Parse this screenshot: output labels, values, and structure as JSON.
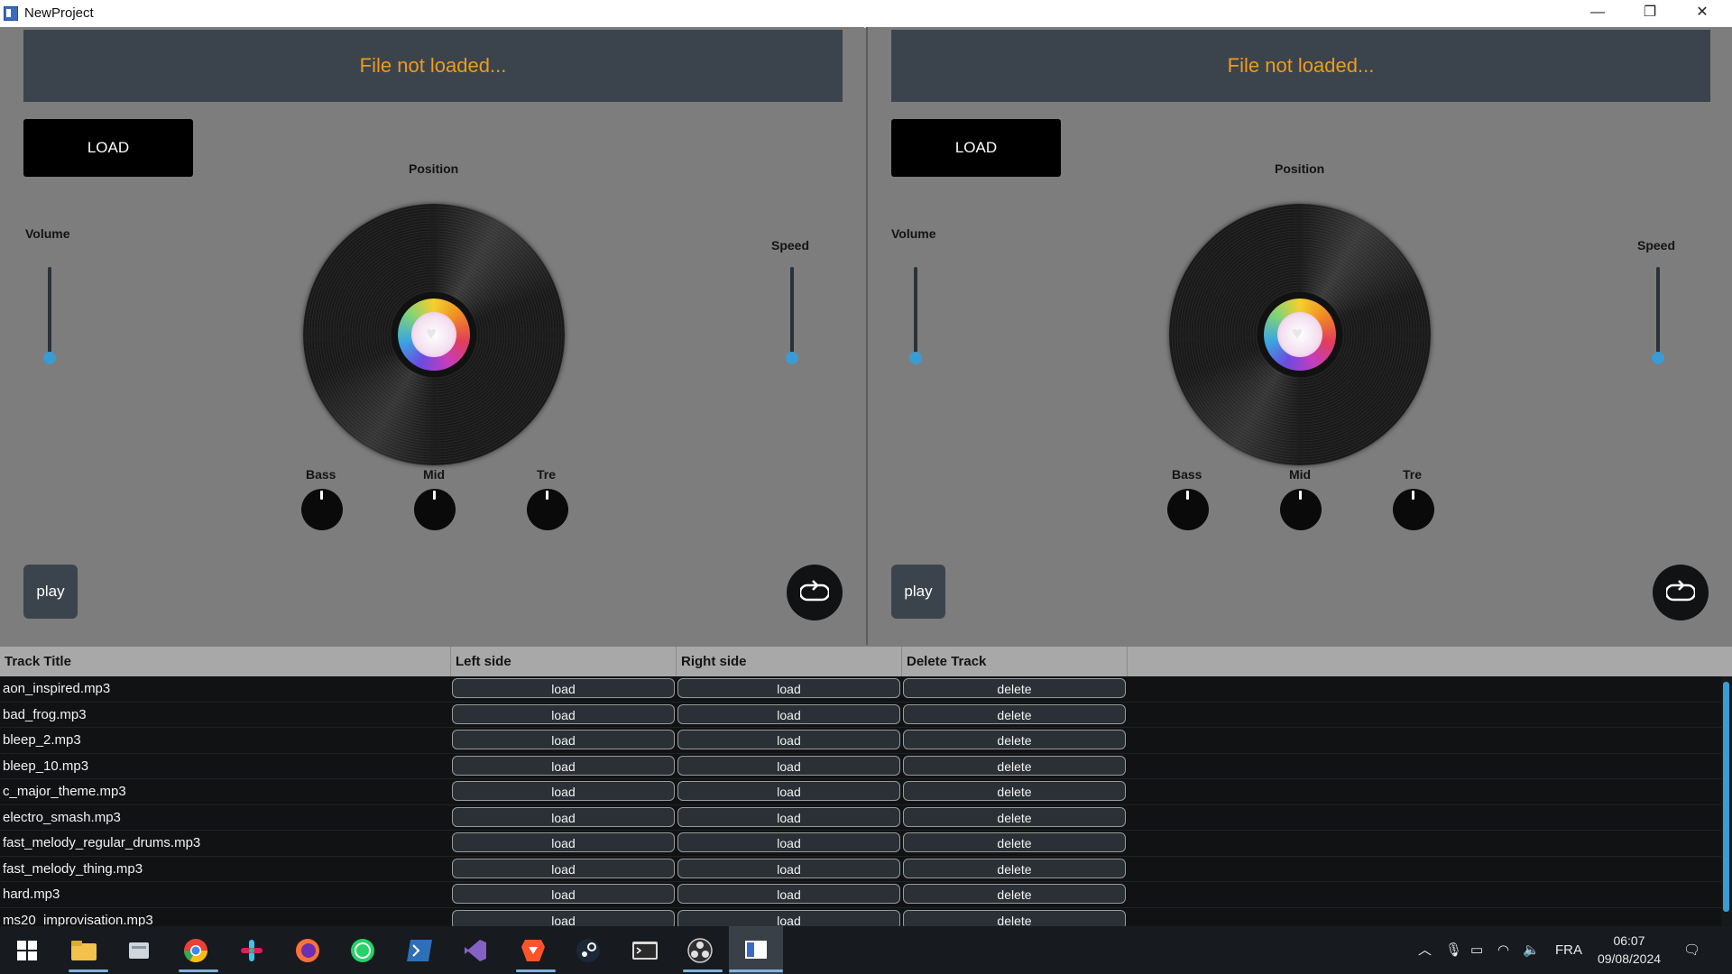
{
  "window": {
    "title": "NewProject",
    "controls": {
      "minimize": "—",
      "restore": "❐",
      "close": "✕"
    }
  },
  "decks": [
    {
      "id": "left",
      "file_status": "File not loaded...",
      "load_label": "LOAD",
      "position_label": "Position",
      "volume_label": "Volume",
      "speed_label": "Speed",
      "volume_level": 0.0,
      "speed_level": 0.0,
      "eq": {
        "bass": "Bass",
        "mid": "Mid",
        "tre": "Tre"
      },
      "play_label": "play"
    },
    {
      "id": "right",
      "file_status": "File not loaded...",
      "load_label": "LOAD",
      "position_label": "Position",
      "volume_label": "Volume",
      "speed_label": "Speed",
      "volume_level": 0.0,
      "speed_level": 0.0,
      "eq": {
        "bass": "Bass",
        "mid": "Mid",
        "tre": "Tre"
      },
      "play_label": "play"
    }
  ],
  "tracklist": {
    "headers": [
      "Track Title",
      "Left side",
      "Right side",
      "Delete Track"
    ],
    "rows": [
      {
        "title": "aon_inspired.mp3",
        "left": "load",
        "right": "load",
        "delete": "delete"
      },
      {
        "title": "bad_frog.mp3",
        "left": "load",
        "right": "load",
        "delete": "delete"
      },
      {
        "title": "bleep_2.mp3",
        "left": "load",
        "right": "load",
        "delete": "delete"
      },
      {
        "title": "bleep_10.mp3",
        "left": "load",
        "right": "load",
        "delete": "delete"
      },
      {
        "title": "c_major_theme.mp3",
        "left": "load",
        "right": "load",
        "delete": "delete"
      },
      {
        "title": "electro_smash.mp3",
        "left": "load",
        "right": "load",
        "delete": "delete"
      },
      {
        "title": "fast_melody_regular_drums.mp3",
        "left": "load",
        "right": "load",
        "delete": "delete"
      },
      {
        "title": "fast_melody_thing.mp3",
        "left": "load",
        "right": "load",
        "delete": "delete"
      },
      {
        "title": "hard.mp3",
        "left": "load",
        "right": "load",
        "delete": "delete"
      },
      {
        "title": "ms20_improvisation.mp3",
        "left": "load",
        "right": "load",
        "delete": "delete"
      }
    ]
  },
  "taskbar": {
    "apps": [
      "windows-start-icon",
      "file-explorer-icon",
      "files-icon",
      "chrome-icon",
      "slack-icon",
      "firefox-icon",
      "whatsapp-icon",
      "powershell-icon",
      "visual-studio-icon",
      "brave-icon",
      "steam-icon",
      "terminal-icon",
      "obs-icon",
      "newproject-app-icon"
    ],
    "language": "FRA",
    "time": "06:07",
    "date": "09/08/2024"
  },
  "colors": {
    "status_text": "#f09a1c",
    "slider_accent": "#3b9bd3",
    "banner_bg": "#3b444d"
  }
}
